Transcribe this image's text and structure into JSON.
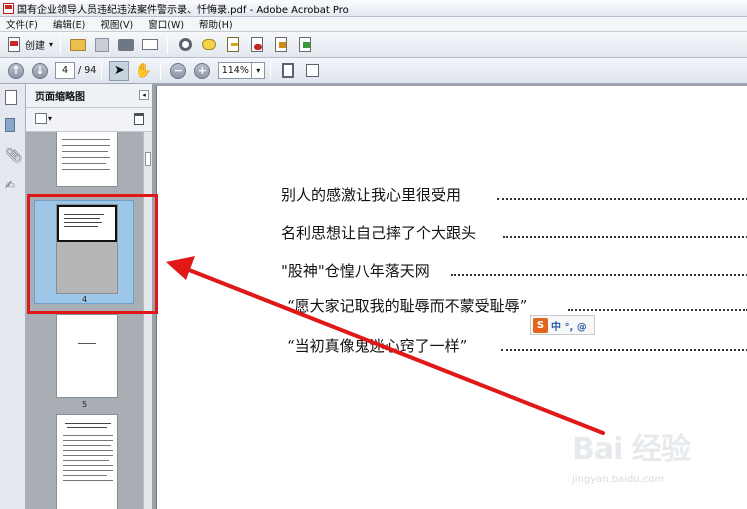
{
  "window": {
    "title": "国有企业领导人员违纪违法案件警示录、忏悔录.pdf - Adobe Acrobat Pro"
  },
  "menu": [
    "文件(F)",
    "编辑(E)",
    "视图(V)",
    "窗口(W)",
    "帮助(H)"
  ],
  "toolbar": {
    "create_label": "创建",
    "page_current": "4",
    "page_total": "/ 94",
    "zoom": "114%"
  },
  "navpane": {
    "title": "页面缩略图",
    "collapse_glyph": "◂",
    "page_labels": [
      "4",
      "5"
    ]
  },
  "document": {
    "lines": [
      "别人的感激让我心里很受用",
      "名利思想让自己摔了个大跟头",
      "\"股神\"仓惶八年落天网",
      "“愿大家记取我的耻辱而不蒙受耻辱”",
      "“当初真像鬼迷心窍了一样”"
    ]
  },
  "ime": {
    "logo": "S",
    "text": "中 °, @"
  },
  "watermark": {
    "brand": "Bai 经验",
    "url": "jingyan.baidu.com"
  },
  "colors": {
    "annotation": "#e01818",
    "thumb_selected": "#9ec6e6"
  }
}
